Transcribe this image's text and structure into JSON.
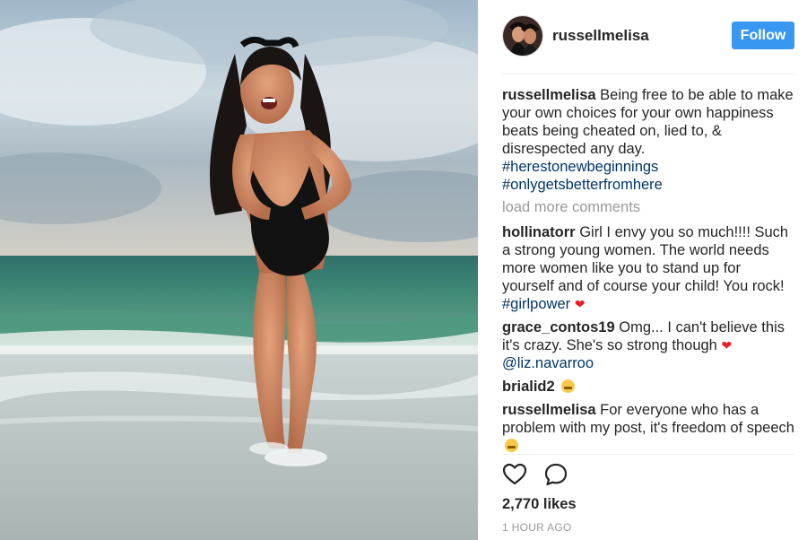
{
  "post": {
    "username": "russellmelisa",
    "follow_label": "Follow",
    "caption": {
      "user": "russellmelisa",
      "text": "Being free to be able to make your own choices for your own happiness beats being cheated on, lied to, & disrespected any day.",
      "hashtags": [
        "#herestonewbeginnings",
        "#onlygetsbetterfromhere"
      ]
    },
    "load_more": "load more comments",
    "comments": [
      {
        "user": "hollinatorr",
        "text": "Girl I envy you so much!!!! Such a strong young women. The world needs more women like you to stand up for yourself and of course your child! You rock! ",
        "tag": "#girlpower",
        "heart": "❤"
      },
      {
        "user": "grace_contos19",
        "text": "Omg... I can't believe this it's crazy. She's so strong though ",
        "heart": "❤",
        "mention": "@liz.navarroo"
      },
      {
        "user": "brialid2",
        "emoji": "grimacing-face-emoji"
      },
      {
        "user": "russellmelisa",
        "text": "For everyone who has a problem with my post, it's freedom of speech",
        "emoji": "kissing-face-emoji"
      }
    ],
    "likes": "2,770 likes",
    "time": "1 HOUR AGO",
    "colors": {
      "follow_button": "#3897f0",
      "hashtag": "#003569",
      "muted": "#999999",
      "heart": "#ed1c24"
    },
    "icons": {
      "like": "heart-outline-icon",
      "comment": "comment-bubble-icon"
    }
  }
}
